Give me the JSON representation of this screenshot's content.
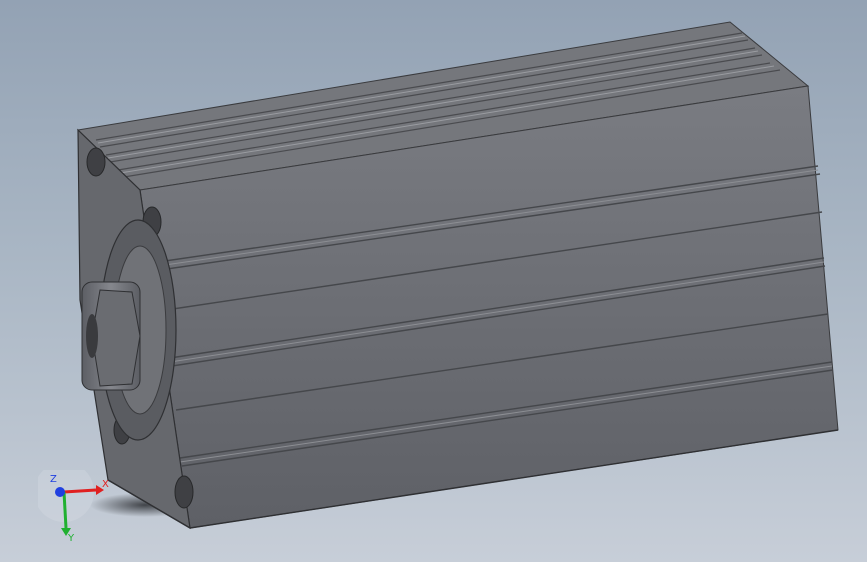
{
  "viewport": {
    "background_top": "#93a2b4",
    "background_bottom": "#c7ced8",
    "model": "pneumatic-compact-cylinder",
    "model_color": "#6e7076"
  },
  "triad": {
    "x_label": "X",
    "y_label": "Y",
    "z_label": "Z",
    "x_color": "#e02020",
    "y_color": "#20b030",
    "z_color": "#2040e0"
  }
}
